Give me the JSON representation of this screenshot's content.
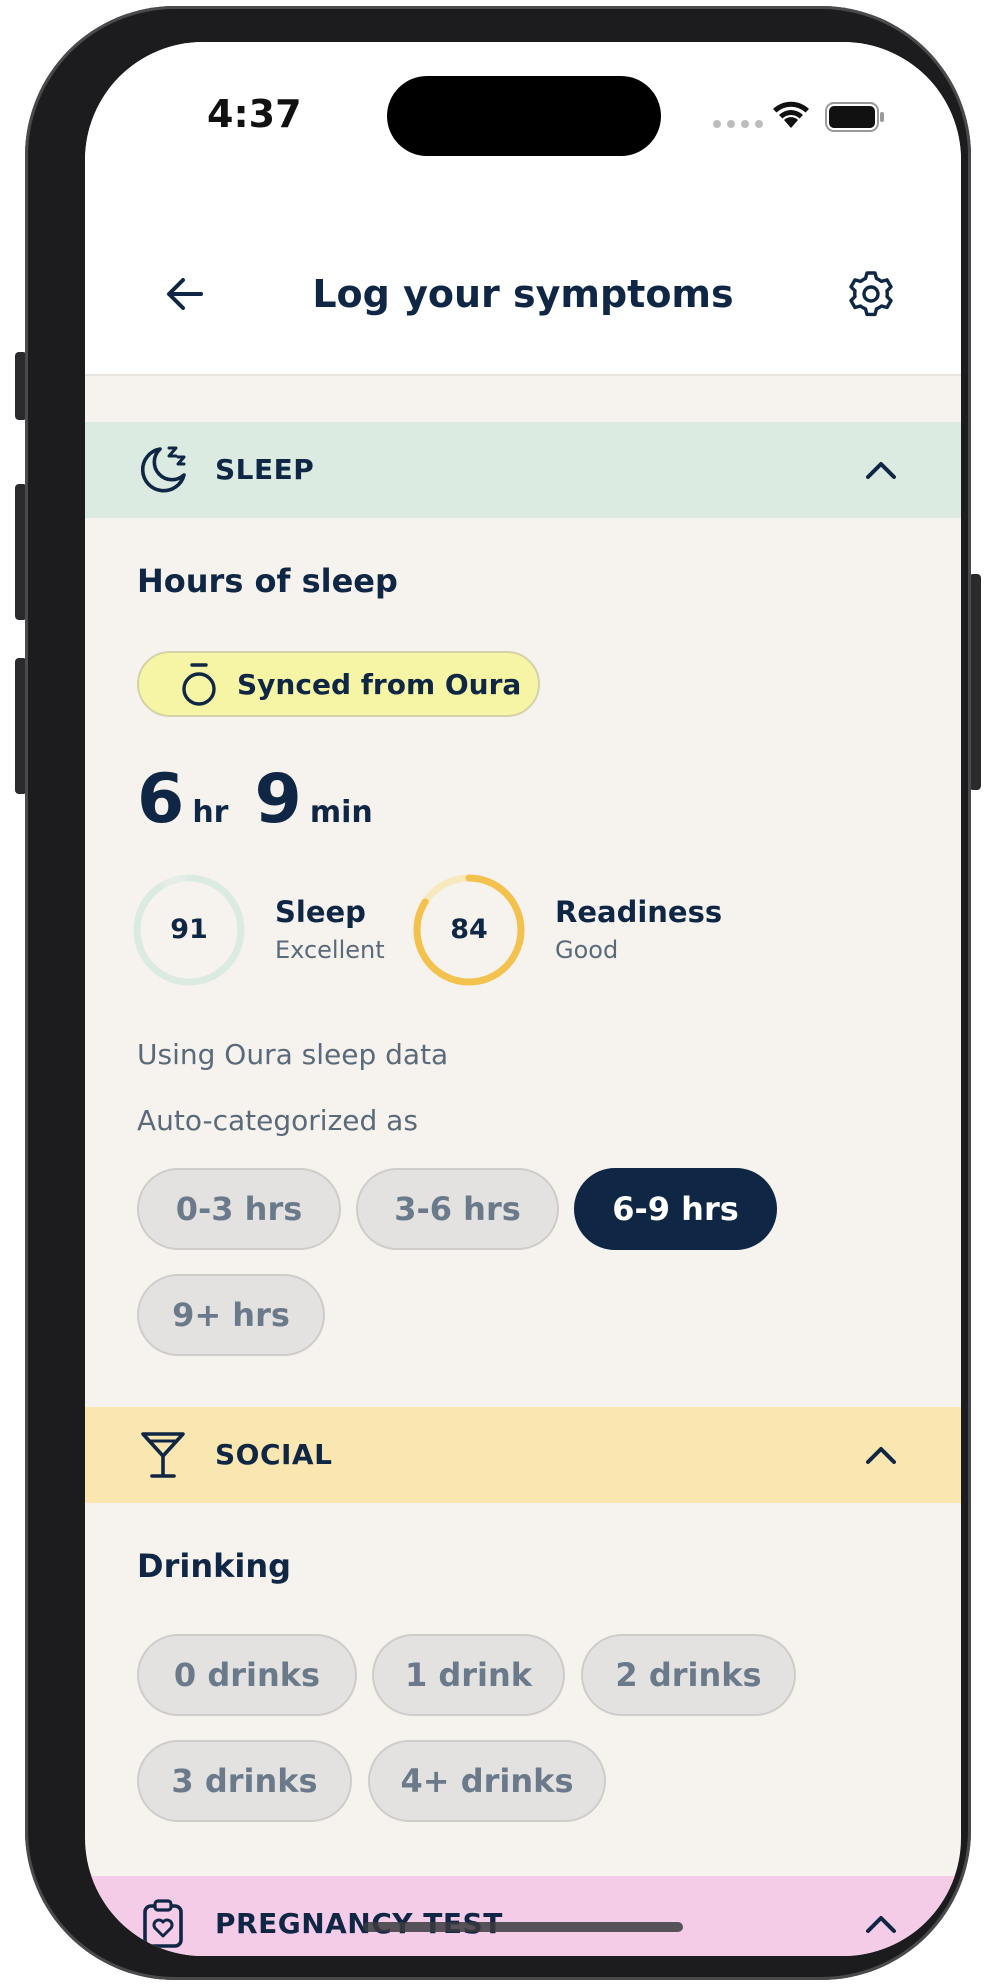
{
  "status_bar": {
    "time": "4:37"
  },
  "header": {
    "title": "Log your symptoms"
  },
  "sleep": {
    "section_label": "SLEEP",
    "subtitle": "Hours of sleep",
    "synced_label": "Synced from Oura",
    "hours": "6",
    "hours_unit": "hr",
    "minutes": "9",
    "minutes_unit": "min",
    "sleep_score": {
      "value": "91",
      "label": "Sleep",
      "rating": "Excellent",
      "fraction": 0.91,
      "color": "#dcebe2"
    },
    "readiness_score": {
      "value": "84",
      "label": "Readiness",
      "rating": "Good",
      "fraction": 0.84,
      "color": "#f3c24e"
    },
    "data_source_note": "Using Oura sleep data",
    "auto_category_note": "Auto-categorized as",
    "options": [
      "0-3 hrs",
      "3-6 hrs",
      "6-9 hrs",
      "9+ hrs"
    ],
    "selected_option": "6-9 hrs"
  },
  "social": {
    "section_label": "SOCIAL",
    "subtitle": "Drinking",
    "options": [
      "0 drinks",
      "1 drink",
      "2 drinks",
      "3 drinks",
      "4+ drinks"
    ]
  },
  "pregnancy": {
    "section_label": "PREGNANCY TEST"
  },
  "colors": {
    "navy": "#0f2744",
    "sleep_band": "#dcebe2",
    "social_band": "#fae6b0",
    "pregnancy_band": "#f5cce8",
    "oura_pill": "#f6f5a6",
    "background": "#f6f3ef"
  }
}
